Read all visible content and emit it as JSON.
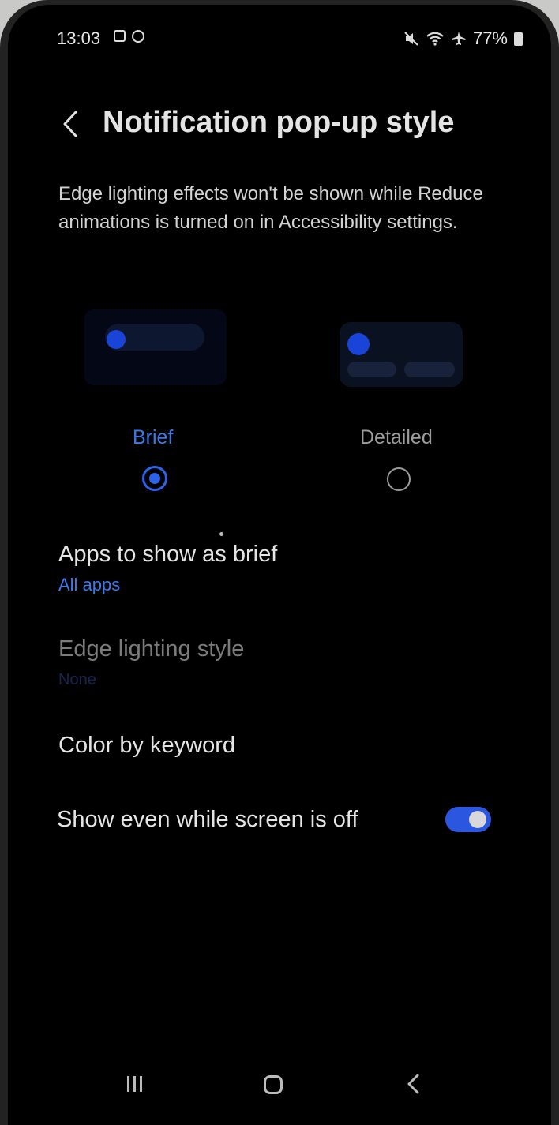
{
  "status_bar": {
    "time": "13:03",
    "battery": "77%"
  },
  "header": {
    "title": "Notification pop-up style"
  },
  "description": "Edge lighting effects won't be shown while Reduce animations is turned on in Accessibility settings.",
  "styles": {
    "brief_label": "Brief",
    "detailed_label": "Detailed",
    "selected": "Brief"
  },
  "settings": {
    "apps_title": "Apps to show as brief",
    "apps_value": "All apps",
    "edge_title": "Edge lighting style",
    "edge_value": "None",
    "color_keyword": "Color by keyword",
    "show_off_title": "Show even while screen is off",
    "show_off_enabled": true
  },
  "colors": {
    "accent": "#2b63ea",
    "background": "#000000"
  }
}
